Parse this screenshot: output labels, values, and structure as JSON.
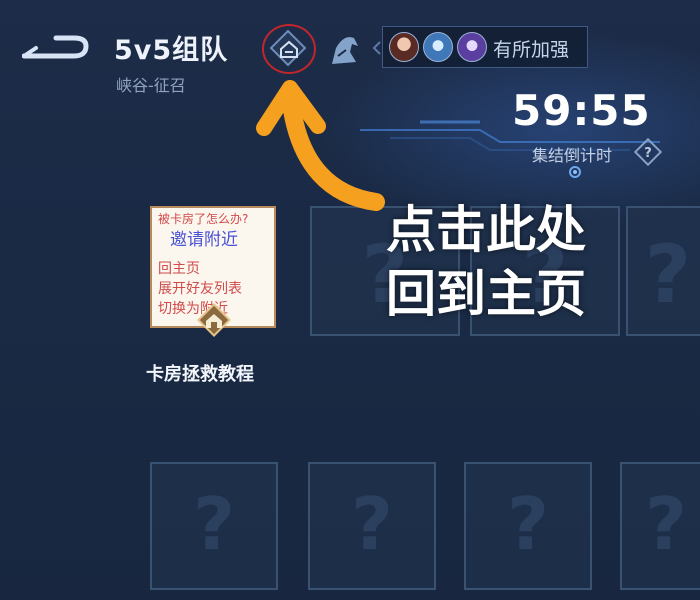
{
  "header": {
    "title": "5v5组队",
    "subtitle": "峡谷-征召",
    "boost_text": "有所加强"
  },
  "countdown": {
    "time": "59:55",
    "label": "集结倒计时"
  },
  "tutorial": {
    "card_lines": [
      "被卡房了怎么办?",
      "邀请附近",
      "回主页",
      "展开好友列表",
      "切换为附近"
    ],
    "label": "卡房拯救教程"
  },
  "slots": {
    "placeholder": "?"
  },
  "annotation": {
    "line1": "点击此处",
    "line2": "回到主页"
  },
  "colors": {
    "background": "#1b2a44",
    "highlight_circle": "#c0262b",
    "annotation_arrow": "#f5a01e"
  },
  "icons": {
    "back": "back-arrow-icon",
    "home": "home-icon",
    "hero": "hero-helmet-icon",
    "help": "question-icon"
  }
}
